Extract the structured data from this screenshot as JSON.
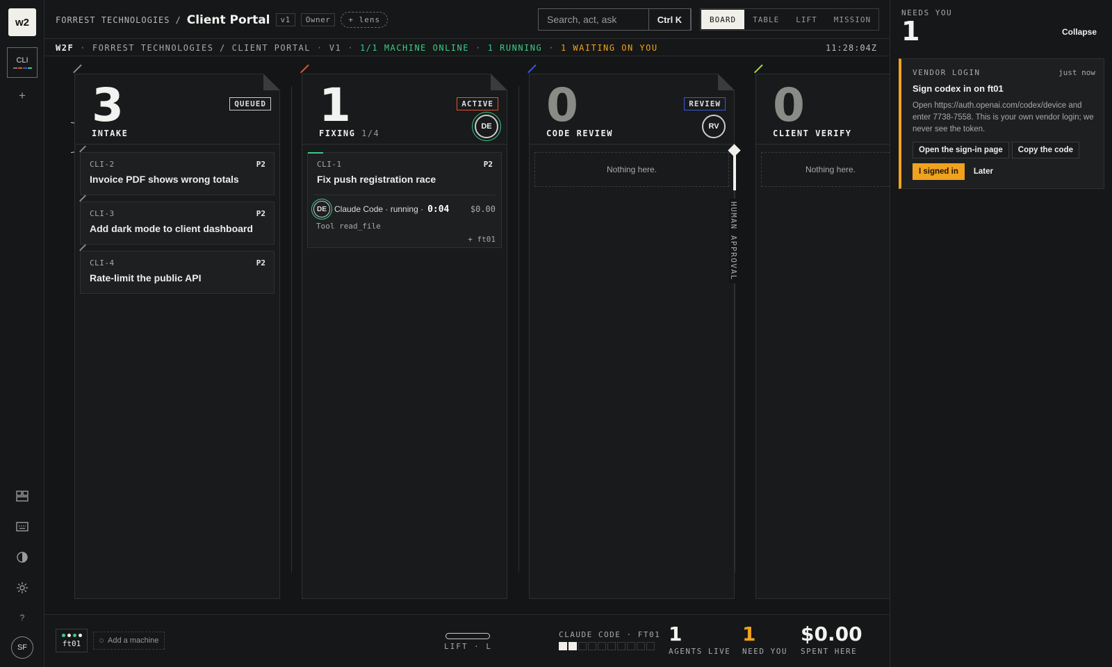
{
  "app": {
    "logo": "w2"
  },
  "rail": {
    "project_tab": "CLI",
    "project_colors": [
      "#7a7b7e",
      "#e0562e",
      "#3a58d6",
      "#3ccb86"
    ],
    "icons": [
      "plus-icon",
      "grid-icon",
      "keyboard-icon",
      "contrast-icon",
      "gear-icon",
      "help-icon"
    ],
    "help_label": "?",
    "user_initials": "SF"
  },
  "header": {
    "org": "FORREST TECHNOLOGIES",
    "separator": "/",
    "project": "Client Portal",
    "version": "v1",
    "role": "Owner",
    "lens": "+ lens",
    "search_placeholder": "Search, act, ask",
    "shortcut": "Ctrl K",
    "views": [
      "BOARD",
      "TABLE",
      "LIFT",
      "MISSION"
    ],
    "active_view": "BOARD"
  },
  "status": {
    "app": "W2F",
    "path": "FORREST TECHNOLOGIES / CLIENT PORTAL",
    "version": "V1",
    "machines": "1/1 MACHINE ONLINE",
    "running": "1 RUNNING",
    "waiting": "1 WAITING ON YOU",
    "clock": "11:28:04Z",
    "colors": {
      "online": "#3ccb86",
      "waiting": "#f0a21e"
    }
  },
  "columns": [
    {
      "count": "3",
      "label": "INTAKE",
      "badge": "QUEUED",
      "accent": "#8a8a86",
      "cards": [
        {
          "id": "CLI-2",
          "priority": "P2",
          "title": "Invoice PDF shows wrong totals"
        },
        {
          "id": "CLI-3",
          "priority": "P2",
          "title": "Add dark mode to client dashboard"
        },
        {
          "id": "CLI-4",
          "priority": "P2",
          "title": "Rate-limit the public API"
        }
      ]
    },
    {
      "count": "1",
      "label": "FIXING",
      "sublabel": "1/4",
      "badge": "ACTIVE",
      "badge_color": "#e0562e",
      "accent": "#e0562e",
      "agent": "DE",
      "cards": [
        {
          "id": "CLI-1",
          "priority": "P2",
          "title": "Fix push registration race",
          "run": {
            "agent": "DE",
            "text": "Claude Code · running ·",
            "time": "0:04",
            "cost": "$0.00",
            "tool": "Tool read_file",
            "machine": "+ ft01"
          }
        }
      ]
    },
    {
      "count": "0",
      "label": "CODE REVIEW",
      "badge": "REVIEW",
      "badge_color": "#3a58d6",
      "accent": "#3a58d6",
      "agent": "RV",
      "empty": "Nothing here."
    },
    {
      "count": "0",
      "label": "CLIENT VERIFY",
      "accent": "#a6d94a",
      "empty": "Nothing here."
    }
  ],
  "approval_gate": "HUMAN APPROVAL",
  "footer": {
    "machine": "ft01",
    "add_machine": "Add a machine",
    "lift": "LIFT · L",
    "agent_name": "CLAUDE CODE · FT01",
    "agent_slots_filled": 2,
    "agent_slots_total": 10,
    "agents_live": "1",
    "agents_live_label": "AGENTS LIVE",
    "need_you": "1",
    "need_you_label": "NEED YOU",
    "spent": "$0.00",
    "spent_label": "SPENT HERE"
  },
  "panel": {
    "title": "NEEDS YOU",
    "count": "1",
    "collapse": "Collapse",
    "item": {
      "type": "VENDOR LOGIN",
      "when": "just now",
      "heading": "Sign codex in on ft01",
      "body": "Open https://auth.openai.com/codex/device and enter 7738-7558. This is your own vendor login; we never see the token.",
      "open_btn": "Open the sign-in page",
      "copy_btn": "Copy the code",
      "signed_btn": "I signed in",
      "later_btn": "Later"
    }
  }
}
